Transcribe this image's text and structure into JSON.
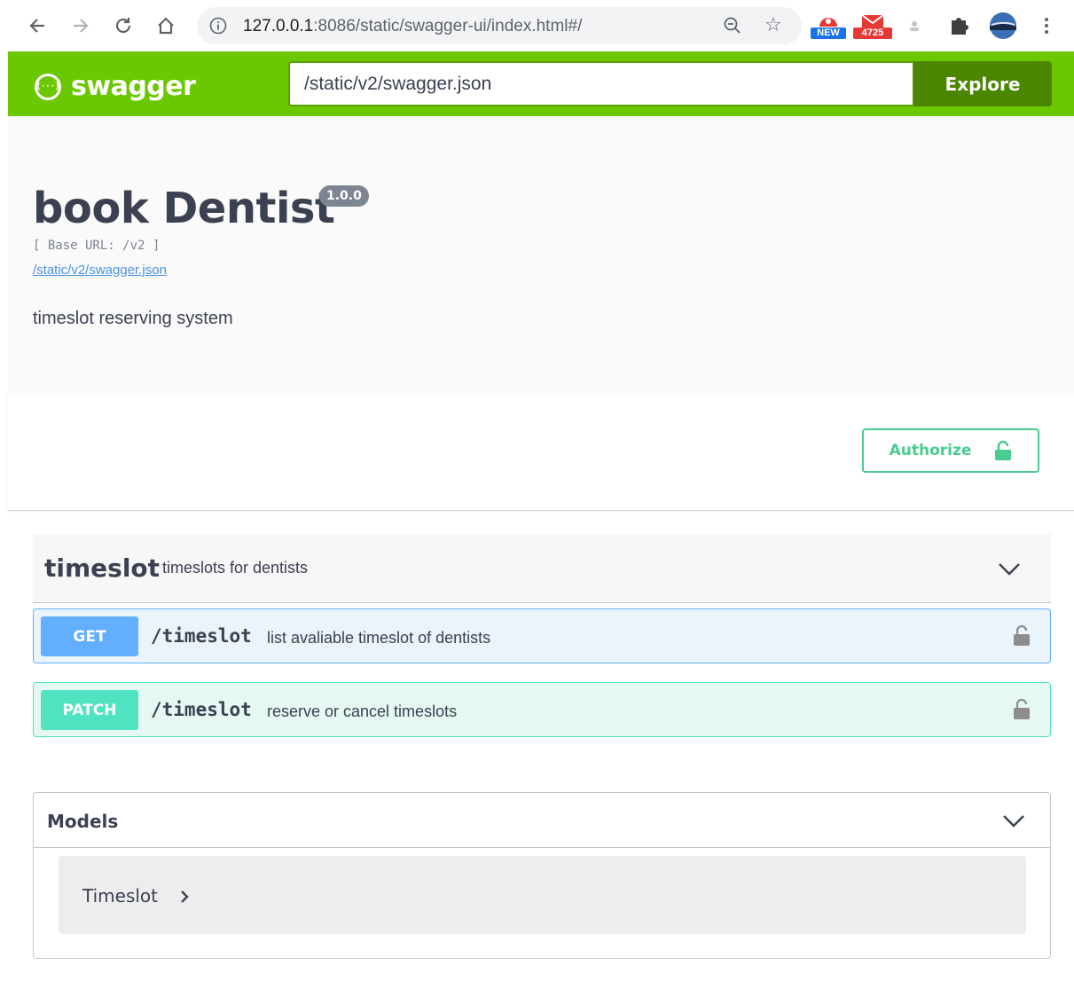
{
  "browser": {
    "url_host": "127.0.0.1",
    "url_rest": ":8086/static/swagger-ui/index.html#/",
    "ext_new_label": "NEW",
    "ext_mail_count": "4725",
    "icons": [
      "back-arrow-icon",
      "forward-arrow-icon",
      "reload-icon",
      "home-icon",
      "info-icon",
      "zoom-icon",
      "star-icon",
      "puzzle-icon",
      "menu-icon"
    ]
  },
  "topbar": {
    "logo_text": "swagger",
    "logo_glyph": "{···}",
    "spec_url_value": "/static/v2/swagger.json",
    "explore_label": "Explore",
    "color": "#6bc700"
  },
  "info": {
    "title": "book Dentist",
    "version": "1.0.0",
    "base_url": "[ Base URL: /v2 ]",
    "spec_link": "/static/v2/swagger.json",
    "description": "timeslot reserving system"
  },
  "auth": {
    "authorize_label": "Authorize",
    "color": "#49cc90"
  },
  "tag": {
    "name": "timeslot",
    "description": "timeslots for dentists",
    "operations": [
      {
        "method": "GET",
        "path": "/timeslot",
        "summary": "list avaliable timeslot of dentists",
        "color": "#61affe"
      },
      {
        "method": "PATCH",
        "path": "/timeslot",
        "summary": "reserve or cancel timeslots",
        "color": "#50e3c2"
      }
    ]
  },
  "models": {
    "title": "Models",
    "items": [
      {
        "name": "Timeslot"
      }
    ]
  }
}
